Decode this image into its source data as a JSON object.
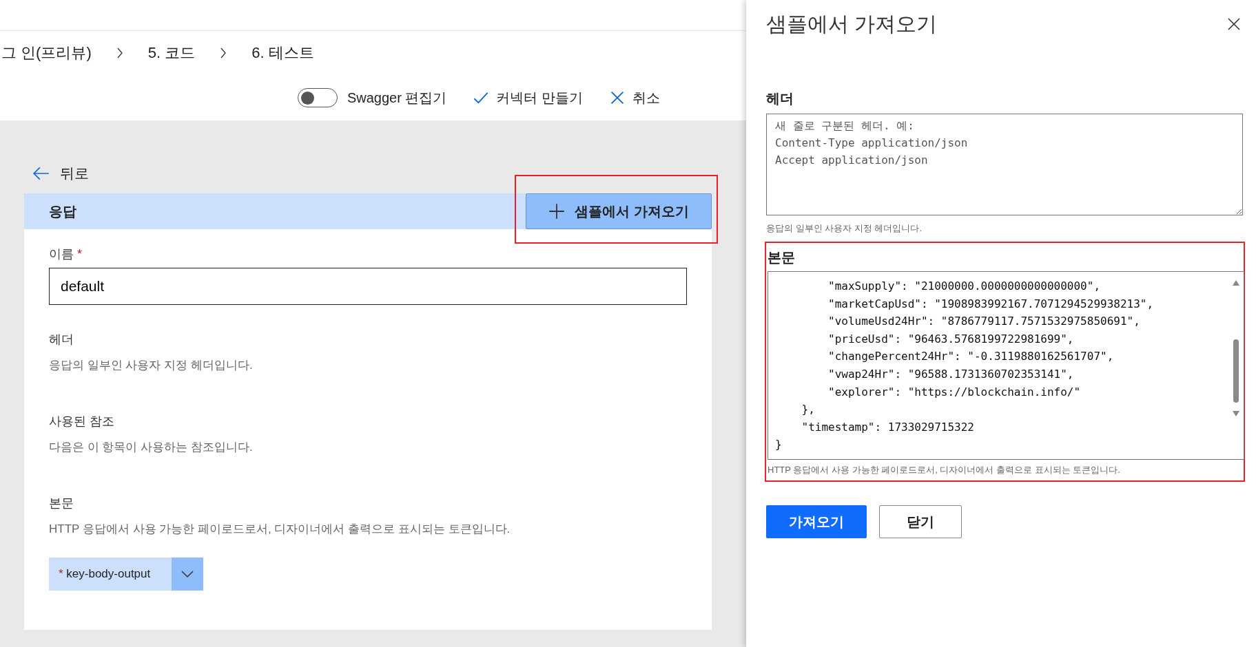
{
  "breadcrumb": [
    "그 인(프리뷰)",
    "5. 코드",
    "6. 테스트"
  ],
  "toolbar": {
    "swagger_toggle": {
      "label": "Swagger 편집기",
      "on": false
    },
    "create": "커넥터 만들기",
    "cancel": "취소"
  },
  "back": "뒤로",
  "response": {
    "title": "응답",
    "import_button": "샘플에서 가져오기",
    "name_label": "이름",
    "name_required": "*",
    "name_value": "default",
    "sections": [
      {
        "title": "헤더",
        "description": "응답의 일부인 사용자 지정 헤더입니다."
      },
      {
        "title": "사용된 참조",
        "description": "다음은 이 항목이 사용하는 참조입니다."
      },
      {
        "title": "본문",
        "description": "HTTP 응답에서 사용 가능한 페이로드로서, 디자이너에서 출력으로 표시되는 토큰입니다."
      }
    ],
    "body_output": {
      "required": "*",
      "label": "key-body-output"
    }
  },
  "panel": {
    "title": "샘플에서 가져오기",
    "headers": {
      "label": "헤더",
      "placeholder": "새 줄로 구분된 헤더. 예:\nContent-Type application/json\nAccept application/json",
      "hint": "응답의 일부인 사용자 지정 헤더입니다."
    },
    "body": {
      "label": "본문",
      "lines": [
        "        \"maxSupply\": \"21000000.0000000000000000\",",
        "        \"marketCapUsd\": \"1908983992167.7071294529938213\",",
        "        \"volumeUsd24Hr\": \"8786779117.7571532975850691\",",
        "        \"priceUsd\": \"96463.5768199722981699\",",
        "        \"changePercent24Hr\": \"-0.3119880162561707\",",
        "        \"vwap24Hr\": \"96588.1731360702353141\",",
        "        \"explorer\": \"https://blockchain.info/\"",
        "    },",
        "    \"timestamp\": 1733029715322",
        "}"
      ],
      "hint": "HTTP 응답에서 사용 가능한 페이로드로서, 디자이너에서 출력으로 표시되는 토큰입니다."
    },
    "buttons": [
      {
        "label": "가져오기",
        "kind": "primary"
      },
      {
        "label": "닫기",
        "kind": "secondary"
      }
    ]
  }
}
